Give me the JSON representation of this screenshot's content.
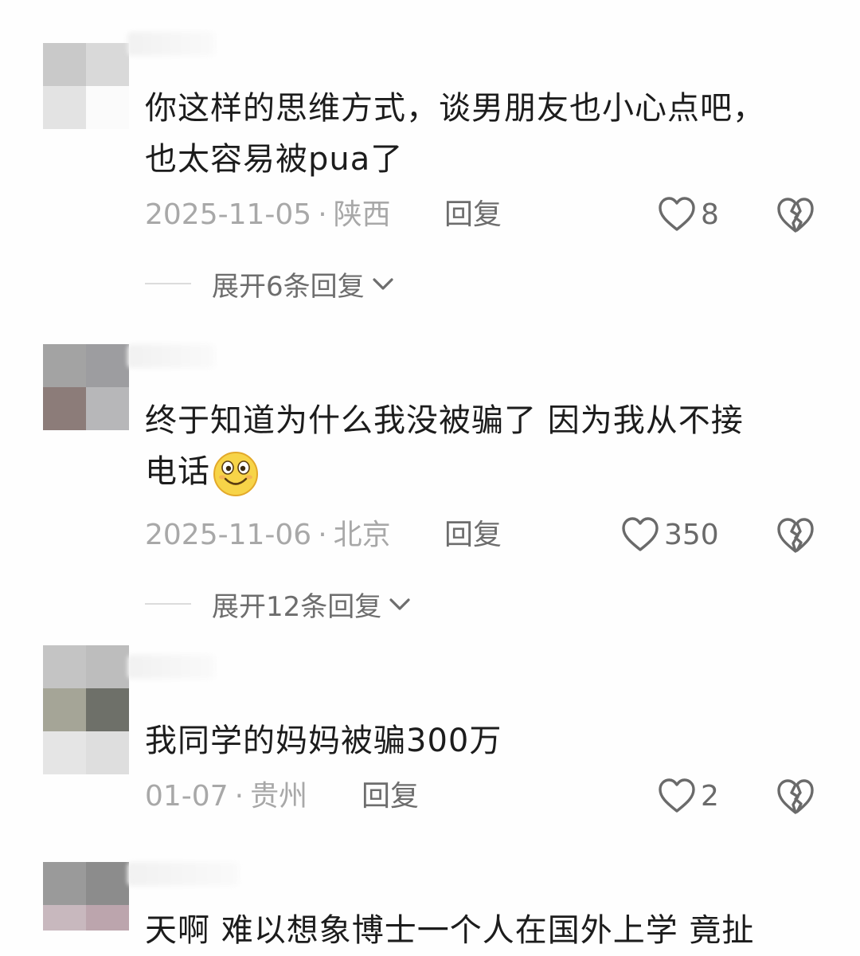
{
  "comments": [
    {
      "text_line1": "你这样的思维方式，谈男朋友也小心点吧，",
      "text_line2": "也太容易被pua了",
      "date": "2025-11-05",
      "location": "陕西",
      "reply": "回复",
      "likes": "8",
      "expand": "展开6条回复",
      "avatar_colors": [
        "#c9c9c9",
        "#d9d9d9",
        "#e3e3e3",
        "#fbfbfb"
      ]
    },
    {
      "text_line1": "终于知道为什么我没被骗了 因为我从不接",
      "text_line2": "电话",
      "emoji": "smile-emoji",
      "date": "2025-11-06",
      "location": "北京",
      "reply": "回复",
      "likes": "350",
      "expand": "展开12条回复",
      "avatar_colors": [
        "#a3a3a3",
        "#9d9da0",
        "#8c7c79",
        "#b7b7b9"
      ]
    },
    {
      "text_line1": "我同学的妈妈被骗300万",
      "date": "01-07",
      "location": "贵州",
      "reply": "回复",
      "likes": "2",
      "avatar_colors": [
        "#c4c4c4",
        "#bdbdbd",
        "#a5a597",
        "#6e7069",
        "#e5e5e5",
        "#dedede"
      ]
    },
    {
      "text_partial": "天啊 难以想象博士一个人在国外上学 竟扯",
      "avatar_colors": [
        "#9a9a9a",
        "#8c8c8c",
        "#c8b8be",
        "#bca5ad"
      ]
    }
  ],
  "icons": {
    "like": "heart-outline-icon",
    "dislike": "broken-heart-icon",
    "expand": "chevron-down-icon"
  },
  "colors": {
    "meta": "#a8a8a8",
    "action": "#6d6d6d",
    "text": "#1c1c1c"
  }
}
